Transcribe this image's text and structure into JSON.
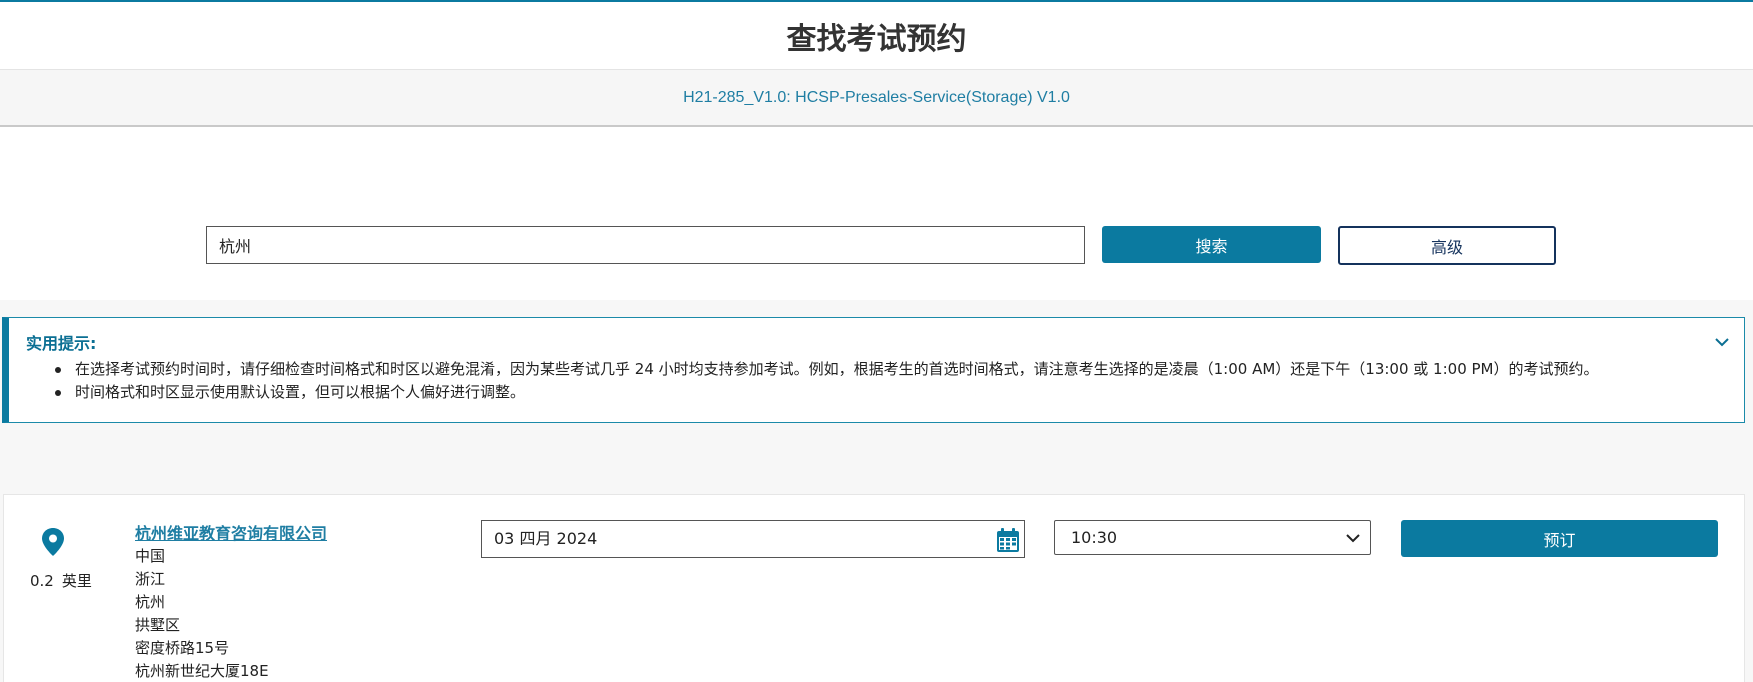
{
  "page": {
    "title": "查找考试预约",
    "exam_name": "H21-285_V1.0: HCSP-Presales-Service(Storage) V1.0"
  },
  "search": {
    "value": "杭州",
    "search_label": "搜索",
    "advanced_label": "高级"
  },
  "tips": {
    "title": "实用提示:",
    "items": [
      "在选择考试预约时间时，请仔细检查时间格式和时区以避免混淆，因为某些考试几乎 24 小时均支持参加考试。例如，根据考生的首选时间格式，请注意考生选择的是凌晨（1:00 AM）还是下午（13:00 或 1:00 PM）的考试预约。",
      "时间格式和时区显示使用默认设置，但可以根据个人偏好进行调整。"
    ]
  },
  "result": {
    "distance": "0.2",
    "distance_unit": "英里",
    "center_name": "杭州维亚教育咨询有限公司",
    "address_lines": [
      "中国",
      "浙江",
      "杭州",
      "拱墅区",
      "密度桥路15号",
      "杭州新世纪大厦18E"
    ],
    "date_value": "03 四月 2024",
    "time_value": "10:30",
    "book_label": "预订"
  },
  "colors": {
    "accent": "#0b7aa0",
    "link": "#1f7ea3",
    "navy": "#14325c"
  },
  "icons": {
    "location": "map-pin-icon",
    "calendar": "calendar-icon",
    "expand": "chevron-down-icon",
    "select": "chevron-down-icon"
  }
}
